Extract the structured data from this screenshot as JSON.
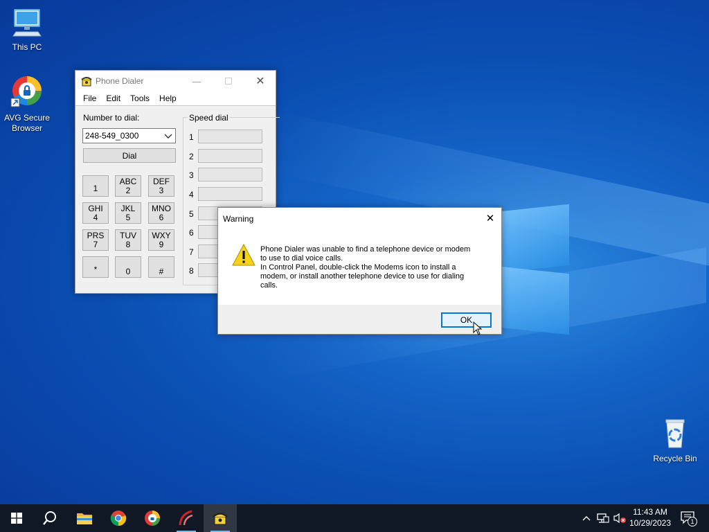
{
  "desktop": {
    "icons": [
      {
        "label": "This PC"
      },
      {
        "label": "AVG Secure Browser"
      },
      {
        "label": "Recycle Bin"
      }
    ]
  },
  "phone_dialer": {
    "title": "Phone Dialer",
    "menu": [
      "File",
      "Edit",
      "Tools",
      "Help"
    ],
    "number_label": "Number to dial:",
    "number_value": "248-549_0300",
    "dial_label": "Dial",
    "keypad": [
      {
        "letters": "",
        "digit": "1"
      },
      {
        "letters": "ABC",
        "digit": "2"
      },
      {
        "letters": "DEF",
        "digit": "3"
      },
      {
        "letters": "GHI",
        "digit": "4"
      },
      {
        "letters": "JKL",
        "digit": "5"
      },
      {
        "letters": "MNO",
        "digit": "6"
      },
      {
        "letters": "PRS",
        "digit": "7"
      },
      {
        "letters": "TUV",
        "digit": "8"
      },
      {
        "letters": "WXY",
        "digit": "9"
      },
      {
        "letters": "",
        "digit": "*"
      },
      {
        "letters": "",
        "digit": "0"
      },
      {
        "letters": "",
        "digit": "#"
      }
    ],
    "speed_dial_label": "Speed dial",
    "speed_dial_numbers": [
      "1",
      "2",
      "3",
      "4",
      "5",
      "6",
      "7",
      "8"
    ]
  },
  "warning_dialog": {
    "title": "Warning",
    "message_line1": "Phone Dialer was unable to find a telephone device or modem",
    "message_line2": "to use to dial voice calls.",
    "message_line3": "In Control Panel, double-click the Modems icon to install a",
    "message_line4": "modem, or install another telephone device to use for dialing",
    "message_line5": "calls.",
    "ok_label": "OK"
  },
  "taskbar": {
    "time": "11:43 AM",
    "date": "10/29/2023",
    "notification_count": "1"
  },
  "colors": {
    "accent": "#0078d7",
    "taskbar": "#101826",
    "warning_yellow": "#f6d21b"
  }
}
